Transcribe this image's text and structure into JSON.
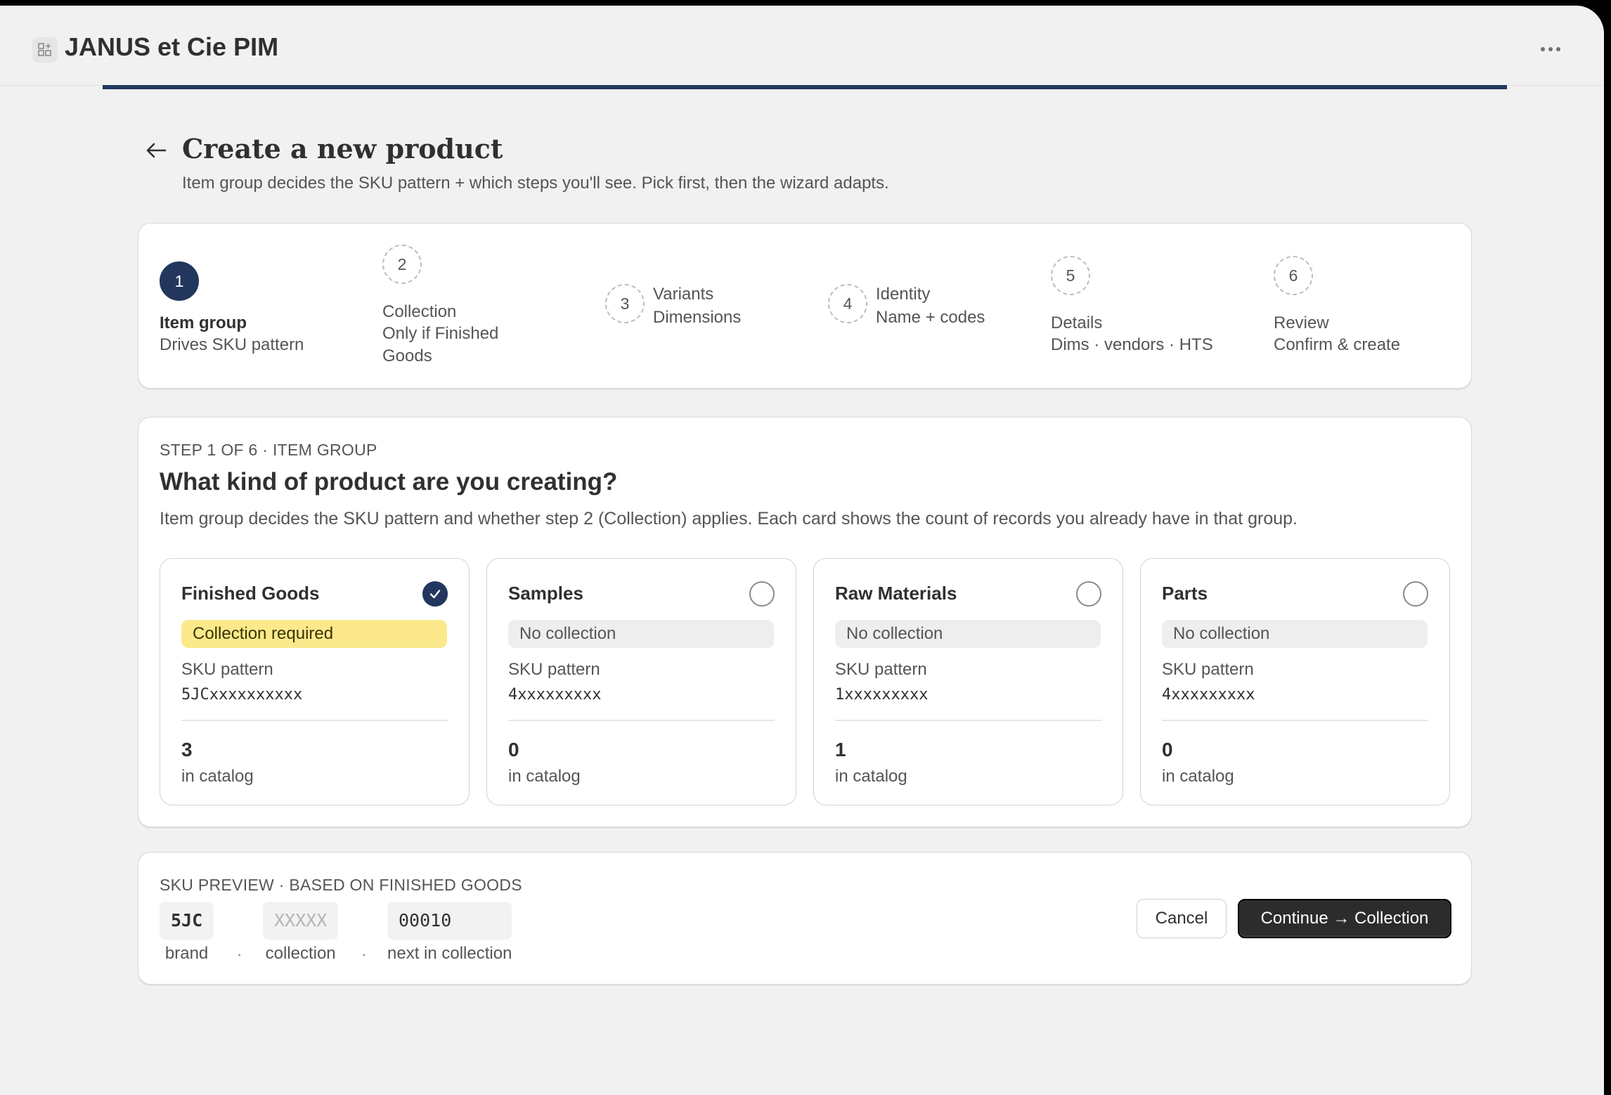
{
  "app": {
    "title": "JANUS et Cie PIM",
    "icon": "grid-plus-icon",
    "menu_icon": "more-horizontal-icon"
  },
  "header": {
    "title": "Create a new product",
    "subtitle": "Item group decides the SKU pattern + which steps you'll see. Pick first, then the wizard adapts."
  },
  "steps": [
    {
      "number": "1",
      "label": "Item group",
      "sub": "Drives SKU pattern",
      "state": "active"
    },
    {
      "number": "2",
      "label": "Collection",
      "sub": "Only if Finished Goods",
      "state": "pending"
    },
    {
      "number": "3",
      "label": "Variants",
      "sub": "Dimensions",
      "state": "pending"
    },
    {
      "number": "4",
      "label": "Identity",
      "sub": "Name + codes",
      "state": "pending"
    },
    {
      "number": "5",
      "label": "Details",
      "sub": "Dims · vendors · HTS",
      "state": "pending"
    },
    {
      "number": "6",
      "label": "Review",
      "sub": "Confirm & create",
      "state": "pending"
    }
  ],
  "main": {
    "overline": "STEP 1 OF 6 · ITEM GROUP",
    "question": "What kind of product are you creating?",
    "description": "Item group decides the SKU pattern and whether step 2 (Collection) applies. Each card shows the count of records you already have in that group.",
    "options": [
      {
        "title": "Finished Goods",
        "pill": "Collection required",
        "sku_label": "SKU pattern",
        "sku": "5JCxxxxxxxxxx",
        "count": "3",
        "count_label": "in catalog",
        "selected": true
      },
      {
        "title": "Samples",
        "pill": "No collection",
        "sku_label": "SKU pattern",
        "sku": "4xxxxxxxxx",
        "count": "0",
        "count_label": "in catalog",
        "selected": false
      },
      {
        "title": "Raw Materials",
        "pill": "No collection",
        "sku_label": "SKU pattern",
        "sku": "1xxxxxxxxx",
        "count": "1",
        "count_label": "in catalog",
        "selected": false
      },
      {
        "title": "Parts",
        "pill": "No collection",
        "sku_label": "SKU pattern",
        "sku": "4xxxxxxxxx",
        "count": "0",
        "count_label": "in catalog",
        "selected": false
      }
    ]
  },
  "preview": {
    "overline": "SKU PREVIEW · BASED ON FINISHED GOODS",
    "segments": [
      {
        "value": "5JC",
        "caption": "brand"
      },
      {
        "value": "XXXXX",
        "caption": "collection"
      },
      {
        "value": "00010",
        "caption": "next in collection"
      }
    ],
    "separator": "·",
    "cancel_label": "Cancel",
    "continue_label": "Continue → Collection"
  },
  "colors": {
    "accent": "#23375e",
    "required_pill": "#fbe98c",
    "primary_button": "#2c2c2c"
  }
}
